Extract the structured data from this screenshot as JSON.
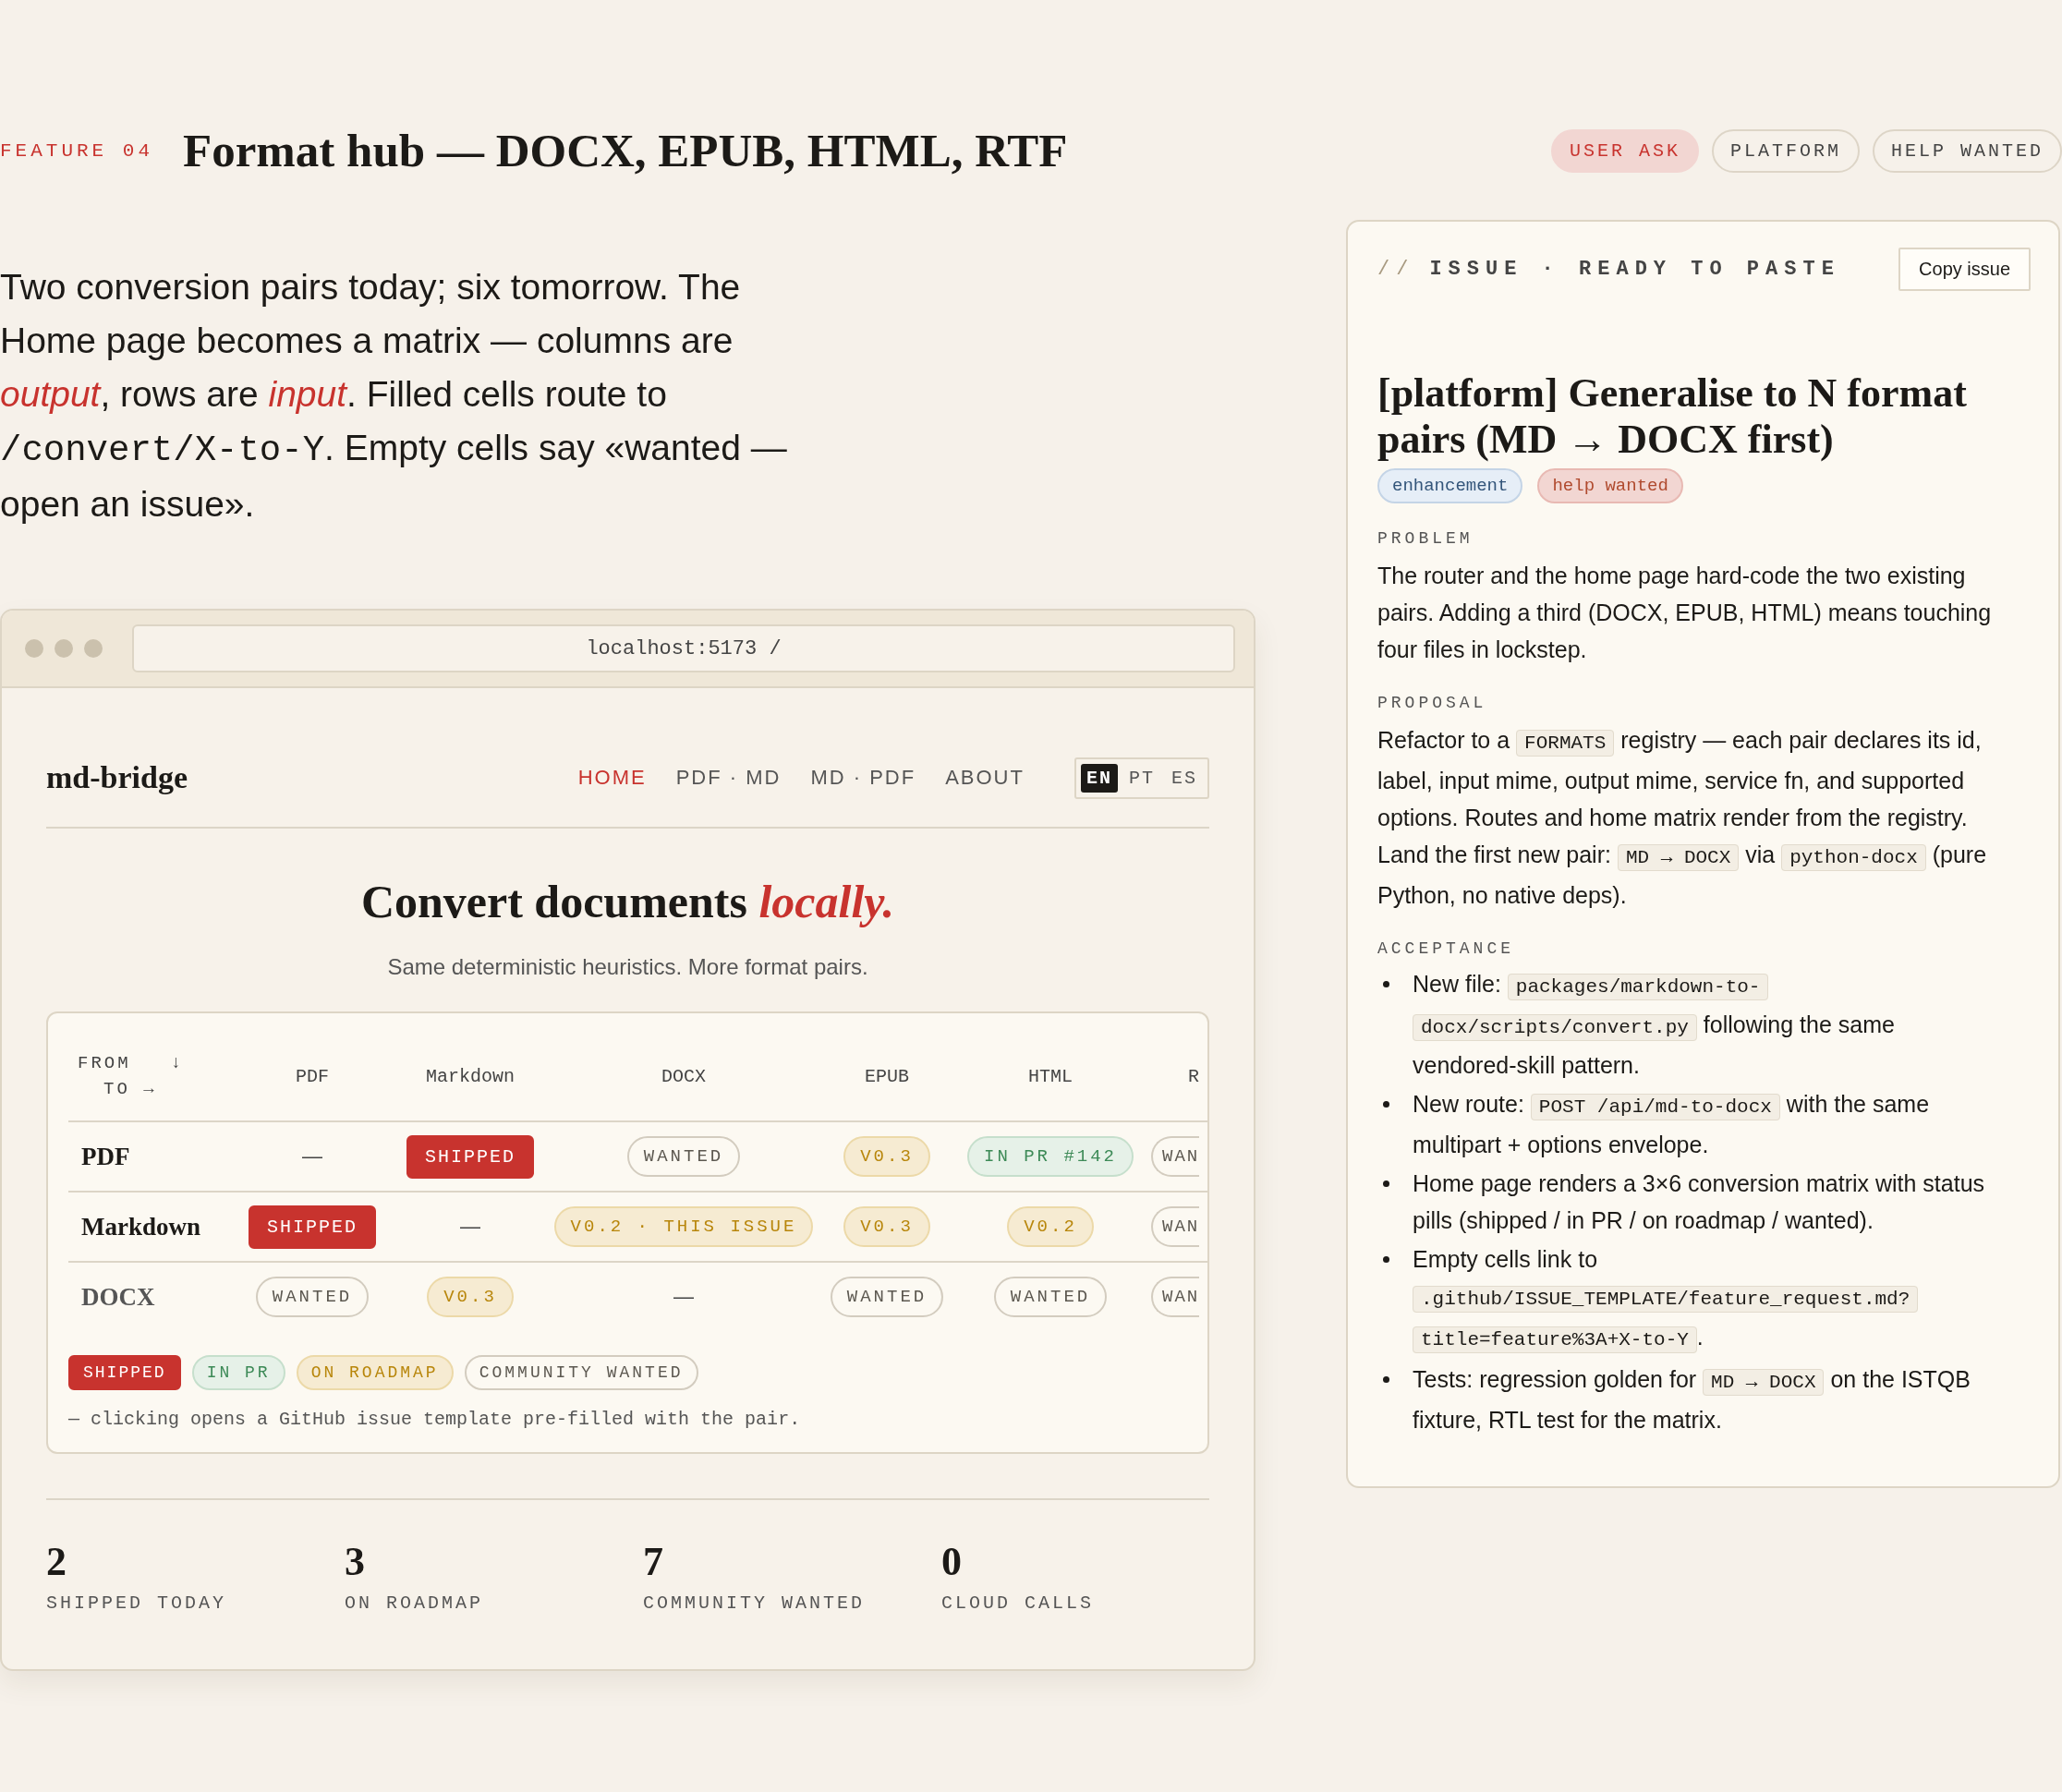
{
  "feature": {
    "eyebrow": "FEATURE 04",
    "title": "Format hub — DOCX, EPUB, HTML, RTF",
    "tags": [
      {
        "kind": "accent",
        "text": "USER ASK"
      },
      {
        "kind": "outline",
        "text": "PLATFORM"
      },
      {
        "kind": "outline",
        "text": "HELP WANTED"
      }
    ]
  },
  "intro": [
    {
      "kind": "text",
      "text": "Two conversion pairs today; six tomorrow. The Home page becomes a matrix — columns are "
    },
    {
      "kind": "em",
      "text": "output"
    },
    {
      "kind": "text",
      "text": ", rows are "
    },
    {
      "kind": "em",
      "text": "input"
    },
    {
      "kind": "text",
      "text": ". Filled cells route to "
    },
    {
      "kind": "mono",
      "text": "/convert/X-to-Y"
    },
    {
      "kind": "text",
      "text": ". Empty cells say «wanted — open an issue»."
    }
  ],
  "browser": {
    "url": "localhost:5173 /",
    "site": {
      "logo": "md-bridge",
      "nav": [
        {
          "label": "HOME",
          "selected": true
        },
        {
          "label": "PDF · MD",
          "selected": false
        },
        {
          "label": "MD · PDF",
          "selected": false
        },
        {
          "label": "ABOUT",
          "selected": false
        }
      ],
      "languages": [
        {
          "label": "EN",
          "selected": true
        },
        {
          "label": "PT",
          "selected": false
        },
        {
          "label": "ES",
          "selected": false
        }
      ],
      "heading": [
        {
          "kind": "text",
          "text": "Convert documents "
        },
        {
          "kind": "em",
          "text": "locally."
        }
      ],
      "subtitle": "Same deterministic heuristics. More format pairs.",
      "matrix": {
        "from_label": "FROM",
        "from_arrow": "↓",
        "to_label": "TO",
        "to_arrow": "→",
        "columns": [
          "PDF",
          "Markdown",
          "DOCX",
          "EPUB",
          "HTML",
          "R"
        ],
        "rows": [
          {
            "label": "PDF",
            "muted": false,
            "cells": [
              {
                "kind": "dash",
                "text": "—"
              },
              {
                "kind": "shipped",
                "text": "SHIPPED"
              },
              {
                "kind": "wanted",
                "text": "WANTED"
              },
              {
                "kind": "roadmap",
                "text": "V0.3"
              },
              {
                "kind": "inpr",
                "text": "IN PR #142"
              },
              {
                "kind": "clipped",
                "text": "WAN"
              }
            ]
          },
          {
            "label": "Markdown",
            "muted": false,
            "cells": [
              {
                "kind": "shipped",
                "text": "SHIPPED"
              },
              {
                "kind": "dash",
                "text": "—"
              },
              {
                "kind": "roadmap",
                "text": "V0.2 · THIS ISSUE"
              },
              {
                "kind": "roadmap",
                "text": "V0.3"
              },
              {
                "kind": "roadmap",
                "text": "V0.2"
              },
              {
                "kind": "clipped",
                "text": "WAN"
              }
            ]
          },
          {
            "label": "DOCX",
            "muted": true,
            "cells": [
              {
                "kind": "wanted",
                "text": "WANTED"
              },
              {
                "kind": "roadmap",
                "text": "V0.3"
              },
              {
                "kind": "dash",
                "text": "—"
              },
              {
                "kind": "wanted",
                "text": "WANTED"
              },
              {
                "kind": "wanted",
                "text": "WANTED"
              },
              {
                "kind": "clipped",
                "text": "WAN"
              }
            ]
          }
        ],
        "legend": [
          {
            "kind": "shipped",
            "text": "SHIPPED"
          },
          {
            "kind": "inpr",
            "text": "IN PR"
          },
          {
            "kind": "roadmap",
            "text": "ON ROADMAP"
          },
          {
            "kind": "wanted",
            "text": "COMMUNITY WANTED"
          }
        ],
        "footnote": "— clicking opens a GitHub issue template pre-filled with the pair."
      },
      "stats": [
        {
          "value": "2",
          "label": "SHIPPED TODAY"
        },
        {
          "value": "3",
          "label": "ON ROADMAP"
        },
        {
          "value": "7",
          "label": "COMMUNITY WANTED"
        },
        {
          "value": "0",
          "label": "CLOUD CALLS"
        }
      ]
    }
  },
  "issue": {
    "eyebrow_mark": "//",
    "eyebrow": "ISSUE · READY TO PASTE",
    "button": "Copy issue",
    "title": "[platform] Generalise to N format pairs (MD → DOCX first)",
    "labels": [
      {
        "kind": "info",
        "text": "enhancement"
      },
      {
        "kind": "alert",
        "text": "help wanted"
      }
    ],
    "sections": [
      {
        "kind": "paragraph",
        "heading": "PROBLEM",
        "body": [
          {
            "kind": "text",
            "text": "The router and the home page hard-code the two existing pairs. Adding a third (DOCX, EPUB, HTML) means touching four files in lockstep."
          }
        ]
      },
      {
        "kind": "paragraph",
        "heading": "PROPOSAL",
        "body": [
          {
            "kind": "text",
            "text": "Refactor to a "
          },
          {
            "kind": "code",
            "text": "FORMATS"
          },
          {
            "kind": "text",
            "text": " registry — each pair declares its id, label, input mime, output mime, service fn, and supported options. Routes and home matrix render from the registry. Land the first new pair: "
          },
          {
            "kind": "code",
            "text": "MD → DOCX"
          },
          {
            "kind": "text",
            "text": " via "
          },
          {
            "kind": "code",
            "text": "python-docx"
          },
          {
            "kind": "text",
            "text": " (pure Python, no native deps)."
          }
        ]
      },
      {
        "kind": "list",
        "heading": "ACCEPTANCE",
        "items": [
          [
            {
              "kind": "text",
              "text": "New file: "
            },
            {
              "kind": "code",
              "text": "packages/markdown-to-docx/scripts/convert.py"
            },
            {
              "kind": "text",
              "text": " following the same vendored-skill pattern."
            }
          ],
          [
            {
              "kind": "text",
              "text": "New route: "
            },
            {
              "kind": "code",
              "text": "POST /api/md-to-docx"
            },
            {
              "kind": "text",
              "text": " with the same multipart + options envelope."
            }
          ],
          [
            {
              "kind": "text",
              "text": "Home page renders a 3×6 conversion matrix with status pills (shipped / in PR / on roadmap / wanted)."
            }
          ],
          [
            {
              "kind": "text",
              "text": "Empty cells link to "
            },
            {
              "kind": "code",
              "text": ".github/ISSUE_TEMPLATE/feature_request.md?title=feature%3A+X-to-Y"
            },
            {
              "kind": "text",
              "text": "."
            }
          ],
          [
            {
              "kind": "text",
              "text": "Tests: regression golden for "
            },
            {
              "kind": "code",
              "text": "MD → DOCX"
            },
            {
              "kind": "text",
              "text": " on the ISTQB fixture, RTL test for the matrix."
            }
          ]
        ]
      }
    ]
  }
}
